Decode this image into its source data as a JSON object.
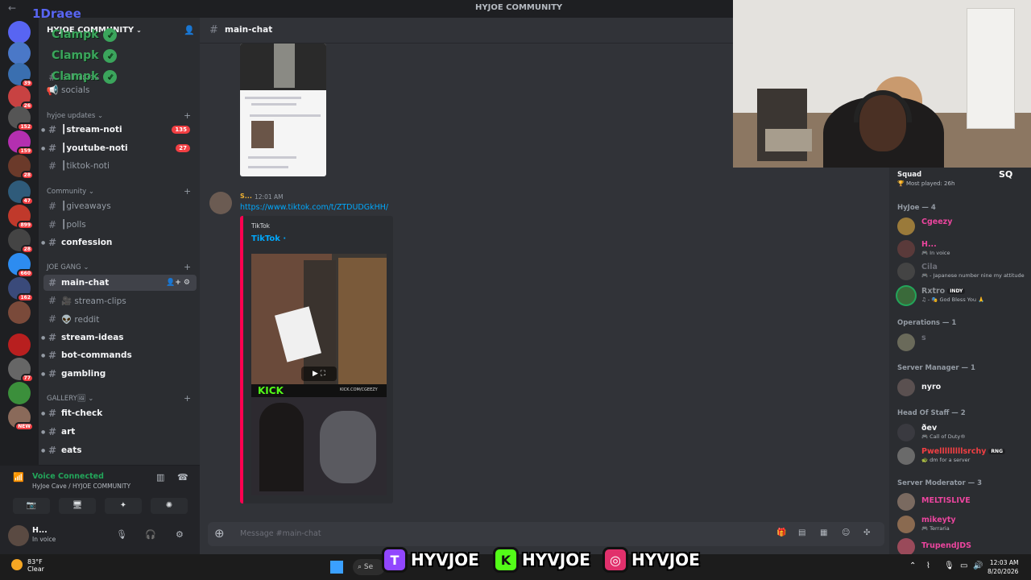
{
  "titlebar": {
    "title": "HYJOE COMMUNITY",
    "back": "←"
  },
  "overlay": {
    "user_label": "1Draee",
    "clamp_lines": [
      "Clampk",
      "Clampk",
      "Clampk"
    ],
    "check": "✓"
  },
  "rail": {
    "servers": [
      {
        "badge": "",
        "color": "#5865f2"
      },
      {
        "badge": "",
        "color": "#4a78c8"
      },
      {
        "badge": "39",
        "color": "#3a6fb0"
      },
      {
        "badge": "26",
        "color": "#c84242"
      },
      {
        "badge": "152",
        "color": "#555"
      },
      {
        "badge": "159",
        "color": "#b42fb0"
      },
      {
        "badge": "28",
        "color": "#6b3a2a"
      },
      {
        "badge": "47",
        "color": "#2f5b7a"
      },
      {
        "badge": "899",
        "color": "#c0392b"
      },
      {
        "badge": "28",
        "color": "#444"
      },
      {
        "badge": "660",
        "color": "#2d8cf0"
      },
      {
        "badge": "162",
        "color": "#3a4a7a"
      },
      {
        "badge": "",
        "color": "#7a4a3a"
      },
      {
        "badge": "",
        "color": "#b81f1f"
      },
      {
        "badge": "77",
        "color": "#666"
      },
      {
        "badge": "",
        "color": "#3b8f3b"
      },
      {
        "badge": "NEW",
        "color": "#8a6a5a"
      }
    ]
  },
  "sidebar": {
    "server_name": "HYJOE COMMUNITY",
    "chev": "⌄",
    "top_channels": [
      "self-roles",
      "socials"
    ],
    "categories": {
      "updates": "hyjoe updates",
      "community": "Community",
      "joegang": "JOE GANG",
      "gallery": "GALLERY🖼"
    },
    "plus": "+",
    "channels": {
      "stream_noti": {
        "label": "┃stream-noti",
        "badge": "135"
      },
      "youtube_noti": {
        "label": "┃youtube-noti",
        "badge": "27"
      },
      "tiktok_noti": {
        "label": "┃tiktok-noti"
      },
      "giveaways": {
        "label": "┃giveaways"
      },
      "polls": {
        "label": "┃polls"
      },
      "confession": {
        "label": "confession"
      },
      "main_chat": {
        "label": "main-chat",
        "icons": "👤+ ⚙"
      },
      "stream_clips": {
        "label": "🎥 stream-clips"
      },
      "reddit": {
        "label": "👽 reddit"
      },
      "stream_ideas": {
        "label": "stream-ideas"
      },
      "bot_commands": {
        "label": "bot-commands"
      },
      "gambling": {
        "label": "gambling"
      },
      "fit_check": {
        "label": "fit-check"
      },
      "art": {
        "label": "art"
      },
      "eats": {
        "label": "eats"
      }
    },
    "hash": "#"
  },
  "voice": {
    "status": "Voice Connected",
    "location": "HyJoe Cave / HYJOE COMMUNITY",
    "buttons": [
      "📷",
      "🖥",
      "✦",
      "✺"
    ]
  },
  "user": {
    "name": "H...",
    "status": "In voice"
  },
  "chat": {
    "channel": "main-chat",
    "message": {
      "author": "S...",
      "time": "12:01 AM",
      "link": "https://www.tiktok.com/t/ZTDUDGkHH/",
      "embed_provider": "TikTok",
      "embed_title": "TikTok · ",
      "kick_text": "KICK",
      "kick_user": "KICK.COM/CGEEZY",
      "play": "▶ ⛶"
    },
    "composer_placeholder": "Message #main-chat"
  },
  "members": {
    "squad": {
      "name": "Squad",
      "sub": "🏆 Most played: 26h",
      "logo": "SQ"
    },
    "groups": [
      {
        "label": "HyJoe — 4"
      },
      {
        "label": "Operations — 1"
      },
      {
        "label": "Server Manager — 1"
      },
      {
        "label": "Head Of Staff — 2"
      },
      {
        "label": "Server Moderator — 3"
      }
    ],
    "list": [
      {
        "name": "Cgeezy",
        "status": "",
        "color": "#eb459e"
      },
      {
        "name": "H...",
        "status": "🎮 In voice",
        "color": "#eb459e"
      },
      {
        "name": "Cila",
        "status": "🎮 - Japanese number nine my attitude",
        "color": "#6d6f78"
      },
      {
        "name": "Rxtro",
        "tag": "INDY",
        "status": "♫ - 🎭 God Bless You 🙏",
        "color": "#6d6f78"
      },
      {
        "name": "s",
        "status": "",
        "color": "#6d6f78"
      },
      {
        "name": "nyro",
        "status": "",
        "color": "#f2f3f5"
      },
      {
        "name": "ðev",
        "status": "🎮 Call of Duty®",
        "color": "#f2f3f5"
      },
      {
        "name": "Pwelllllllllsrchy",
        "tag": "RNG",
        "status": "🐢 dm for a server",
        "color": "#f23f43"
      },
      {
        "name": "MELTISLIVE",
        "status": "",
        "color": "#eb459e"
      },
      {
        "name": "mikeyty",
        "status": "🎮 Terraria",
        "color": "#eb459e"
      },
      {
        "name": "TrupendJDS",
        "status": "",
        "color": "#eb459e"
      }
    ]
  },
  "taskbar": {
    "temp": "83°F",
    "cond": "Clear",
    "search": "Se",
    "time": "12:03 AM",
    "date": "8/20/2026"
  },
  "socials": {
    "items": [
      {
        "icon": "T",
        "label": "HYVJOE",
        "color": "#9146ff"
      },
      {
        "icon": "K",
        "label": "HYVJOE",
        "color": "#53fc18"
      },
      {
        "icon": "◎",
        "label": "HYVJOE",
        "color": "#e1306c"
      }
    ]
  }
}
